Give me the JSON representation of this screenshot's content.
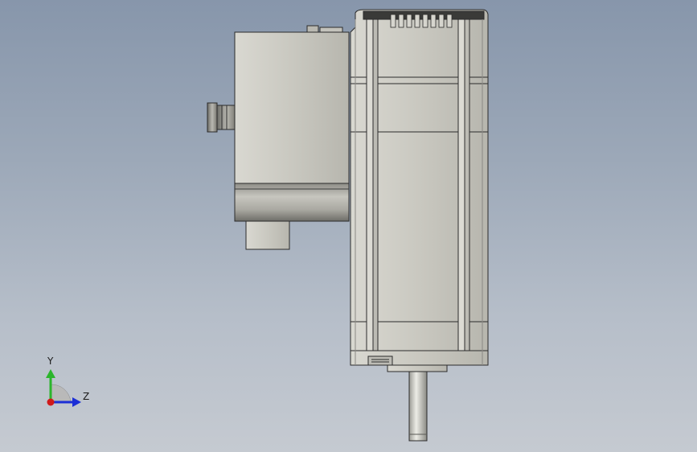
{
  "viewport": {
    "background_top": "#8796ab",
    "background_bottom": "#c5cad1"
  },
  "model": {
    "body_color": "#c9c8c0",
    "edge_color": "#2b2b2b",
    "shaft_color": "#d8d8d2"
  },
  "triad": {
    "y_label": "Y",
    "z_label": "Z",
    "y_color": "#2bb52b",
    "z_color": "#1c2fd6",
    "x_color": "#d01a1a"
  }
}
